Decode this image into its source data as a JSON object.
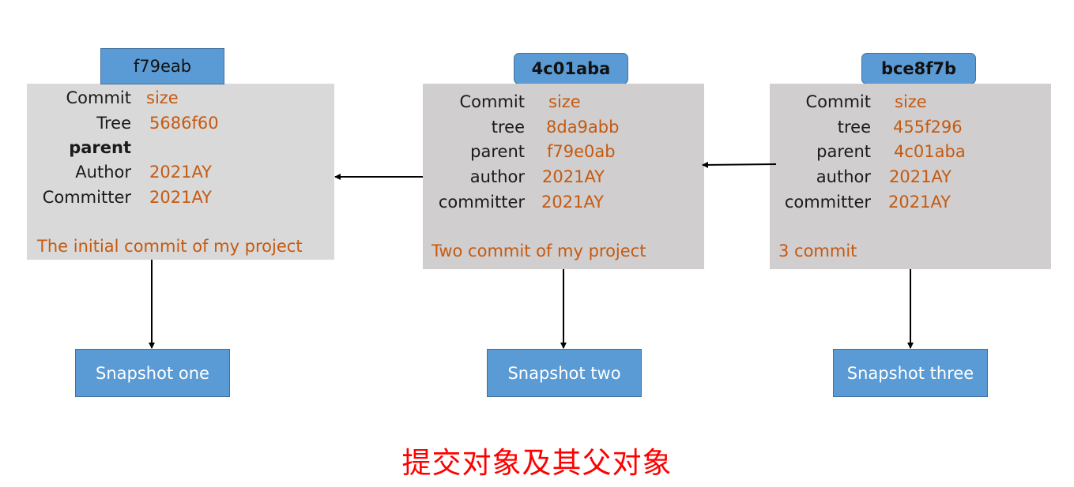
{
  "commits": [
    {
      "hash": "f79eab",
      "fields": [
        {
          "key": "Commit",
          "value": "size"
        },
        {
          "key": "Tree",
          "value": "5686f60"
        },
        {
          "key": "parent",
          "value": ""
        },
        {
          "key": "Author",
          "value": "2021AY"
        },
        {
          "key": "Committer",
          "value": "2021AY"
        }
      ],
      "message": "The initial commit of my project",
      "snapshot": "Snapshot one"
    },
    {
      "hash": "4c01aba",
      "fields": [
        {
          "key": "Commit",
          "value": "size"
        },
        {
          "key": "tree",
          "value": "8da9abb"
        },
        {
          "key": "parent",
          "value": "f79e0ab"
        },
        {
          "key": "author",
          "value": "2021AY"
        },
        {
          "key": "committer",
          "value": "2021AY"
        }
      ],
      "message": "Two commit of my project",
      "snapshot": "Snapshot two"
    },
    {
      "hash": "bce8f7b",
      "fields": [
        {
          "key": "Commit",
          "value": "size"
        },
        {
          "key": "tree",
          "value": "455f296"
        },
        {
          "key": "parent",
          "value": "4c01aba"
        },
        {
          "key": "author",
          "value": "2021AY"
        },
        {
          "key": "committer",
          "value": "2021AY"
        }
      ],
      "message": "3 commit",
      "snapshot": "Snapshot three"
    }
  ],
  "caption": "提交对象及其父对象",
  "colors": {
    "label_blue": "#5b9bd5",
    "value_orange": "#c55a11",
    "caption_red": "#ff0000",
    "box_gray_1": "#d9d9d9",
    "box_gray_2": "#d0cece"
  }
}
